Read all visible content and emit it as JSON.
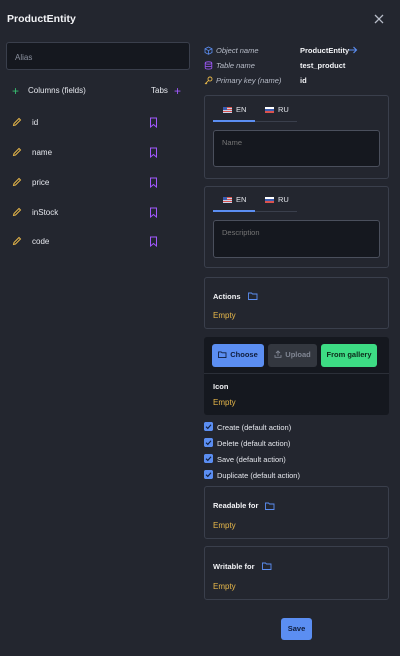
{
  "dialog": {
    "title": "ProductEntity"
  },
  "alias": {
    "placeholder": "Alias"
  },
  "columns": {
    "header": "Columns (fields)",
    "tabs_label": "Tabs",
    "items": [
      "id",
      "name",
      "price",
      "inStock",
      "code"
    ]
  },
  "info": {
    "object_name_key": "Object name",
    "object_name_val": "ProductEntity",
    "table_name_key": "Table name",
    "table_name_val": "test_product",
    "primary_key_key": "Primary key (name)",
    "primary_key_val": "id"
  },
  "name_card": {
    "tab_en": "EN",
    "tab_ru": "RU",
    "placeholder": "Name"
  },
  "desc_card": {
    "tab_en": "EN",
    "tab_ru": "RU",
    "placeholder": "Description"
  },
  "actions": {
    "title": "Actions",
    "value": "Empty"
  },
  "icon_panel": {
    "choose": "Choose",
    "upload": "Upload",
    "gallery": "From gallery",
    "title": "Icon",
    "value": "Empty"
  },
  "checkboxes": [
    "Create (default action)",
    "Delete (default action)",
    "Save (default action)",
    "Duplicate (default action)"
  ],
  "readable": {
    "title": "Readable for",
    "value": "Empty"
  },
  "writable": {
    "title": "Writable for",
    "value": "Empty"
  },
  "save_label": "Save",
  "colors": {
    "accent": "#5b8ef2",
    "green": "#3ddc84",
    "purple": "#a259ff",
    "yellow": "#e8b84a"
  }
}
